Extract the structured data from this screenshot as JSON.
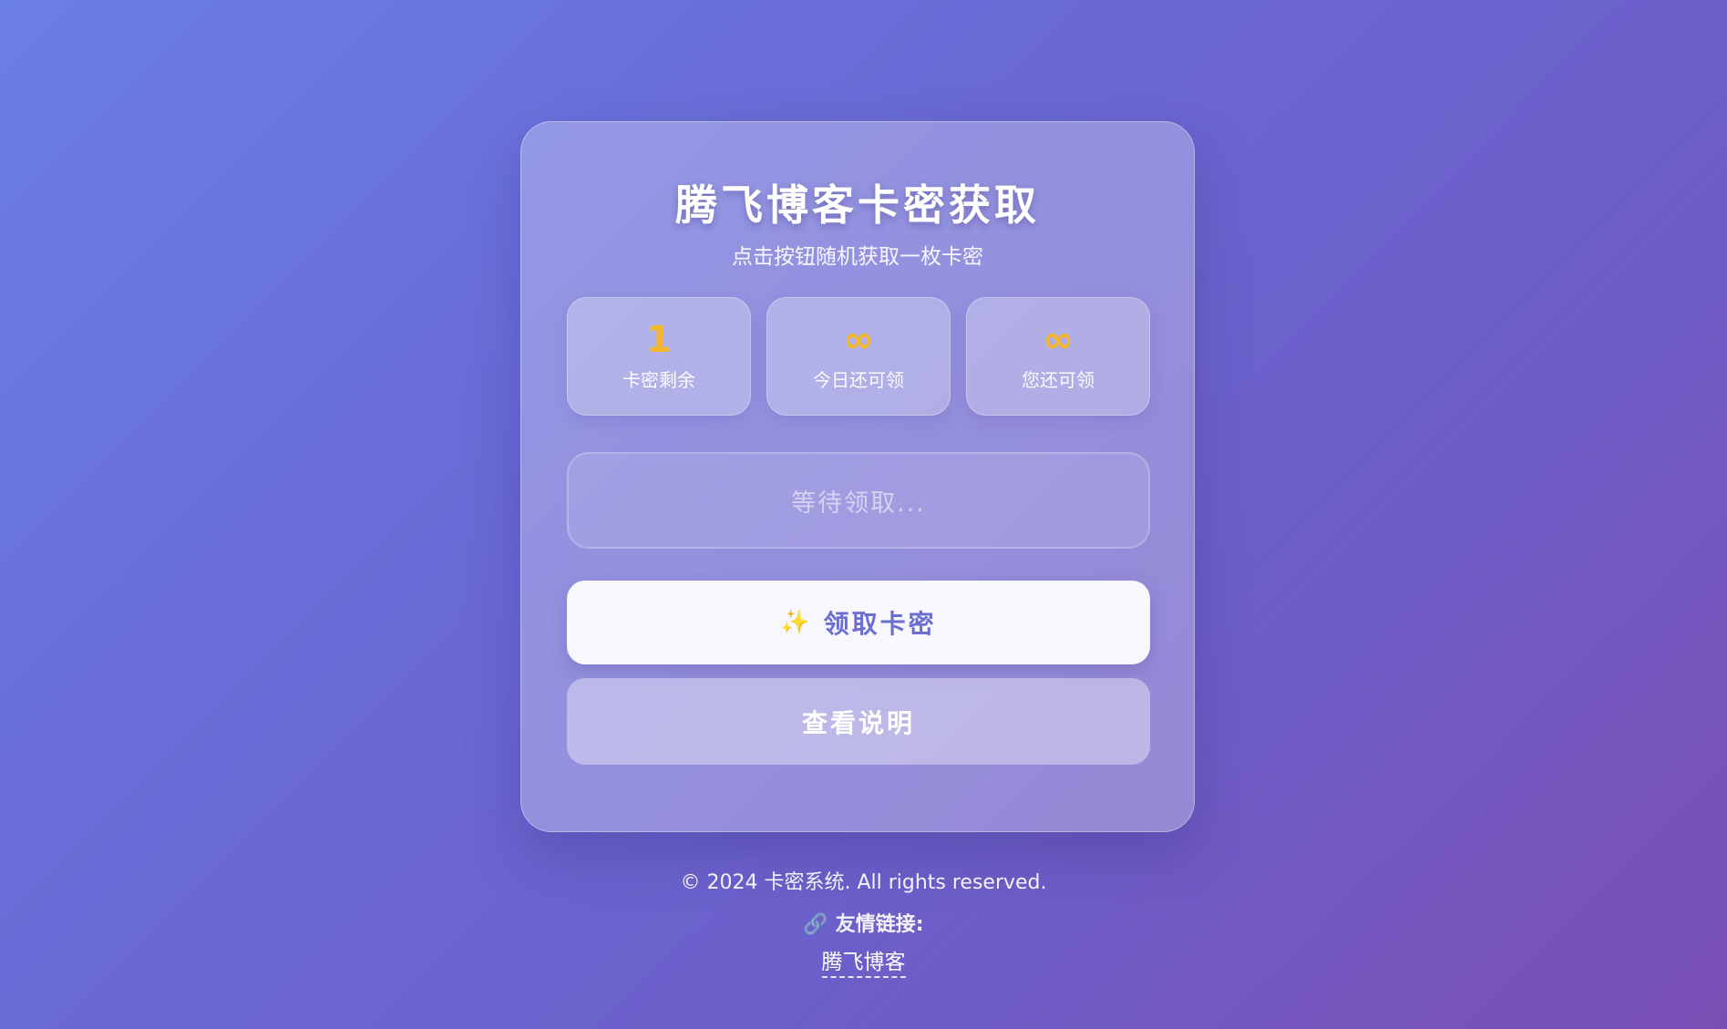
{
  "card": {
    "title": "腾飞博客卡密获取",
    "subtitle": "点击按钮随机获取一枚卡密"
  },
  "stats": [
    {
      "value": "1",
      "label": "卡密剩余"
    },
    {
      "value": "∞",
      "label": "今日还可领"
    },
    {
      "value": "∞",
      "label": "您还可领"
    }
  ],
  "result": {
    "placeholder_text": "等待领取..."
  },
  "buttons": {
    "claim_icon": "✨",
    "claim_label": "领取卡密",
    "info_label": "查看说明"
  },
  "footer": {
    "copyright": "© 2024 卡密系统. All rights reserved.",
    "links_icon": "🔗",
    "links_title": "友情链接:",
    "links": [
      {
        "label": "腾飞博客"
      }
    ]
  },
  "colors": {
    "accent_number": "#f5b82a",
    "primary_button_text": "#6a6fd0"
  },
  "icons": {
    "claim": "sparkles-icon",
    "links": "link-icon"
  }
}
